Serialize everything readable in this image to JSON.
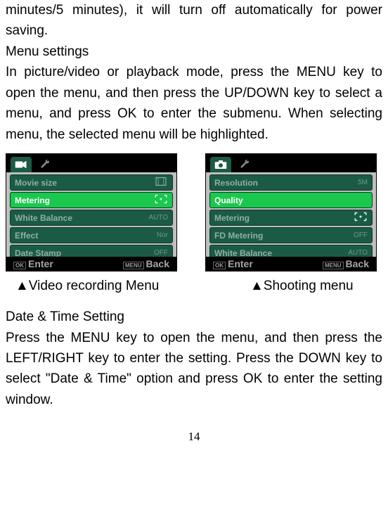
{
  "text": {
    "para1": "minutes/5 minutes), it will turn off automatically for power saving.",
    "heading1": "Menu settings",
    "para2": "In picture/video or playback mode, press the MENU key to open the menu, and then press the UP/DOWN key to select a menu, and press OK to enter the submenu. When selecting menu, the selected menu will be highlighted.",
    "caption_left": "▲Video recording Menu",
    "caption_right": "▲Shooting menu",
    "heading2": "Date & Time Setting",
    "para3": "Press the MENU key to open the menu, and then press the LEFT/RIGHT key to enter the setting. Press the DOWN key to select \"Date & Time\" option and press OK to enter the setting window.",
    "pagenum": "14"
  },
  "menu_left": {
    "items": [
      {
        "label": "Movie size",
        "value": ""
      },
      {
        "label": "Metering",
        "value": ""
      },
      {
        "label": "White Balance",
        "value": "AUTO"
      },
      {
        "label": "Effect",
        "value": "Nor"
      },
      {
        "label": "Date Stamp",
        "value": "OFF"
      }
    ],
    "selected_index": 1,
    "footer_left": "Enter",
    "footer_right": "Back",
    "footer_key_left": "OK",
    "footer_key_right": "MENU"
  },
  "menu_right": {
    "items": [
      {
        "label": "Resolution",
        "value": "5M"
      },
      {
        "label": "Quality",
        "value": ""
      },
      {
        "label": "Metering",
        "value": ""
      },
      {
        "label": "FD Metering",
        "value": "OFF"
      },
      {
        "label": "White Balance",
        "value": "AUTO"
      }
    ],
    "selected_index": 1,
    "footer_left": "Enter",
    "footer_right": "Back",
    "footer_key_left": "OK",
    "footer_key_right": "MENU"
  }
}
